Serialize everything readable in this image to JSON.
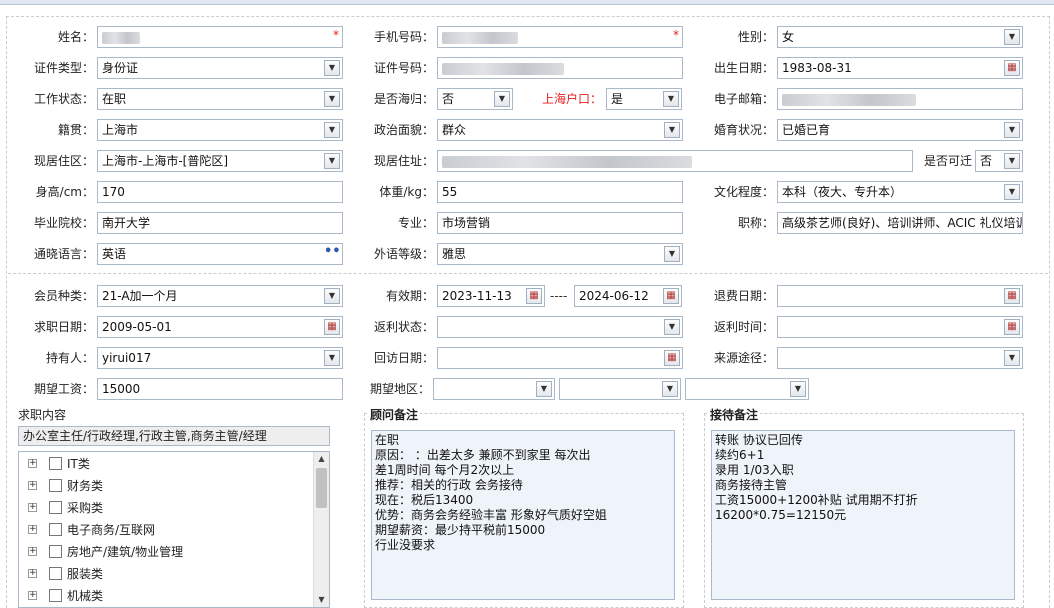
{
  "personal": {
    "name_label": "姓名：",
    "mobile_label": "手机号码：",
    "gender_label": "性别：",
    "gender_value": "女",
    "id_type_label": "证件类型：",
    "id_type_value": "身份证",
    "id_number_label": "证件号码：",
    "birth_label": "出生日期：",
    "birth_value": "1983-08-31",
    "work_status_label": "工作状态：",
    "work_status_value": "在职",
    "returnee_label": "是否海归：",
    "returnee_value": "否",
    "sh_hukou_label": "上海户口：",
    "sh_hukou_value": "是",
    "email_label": "电子邮箱：",
    "origin_label": "籍贯：",
    "origin_value": "上海市",
    "political_label": "政治面貌：",
    "political_value": "群众",
    "marital_label": "婚育状况：",
    "marital_value": "已婚已育",
    "residence_area_label": "现居住区：",
    "residence_area_value": "上海市-上海市-[普陀区]",
    "address_label": "现居住址：",
    "relocate_label": "是否可迁",
    "relocate_value": "否",
    "height_label": "身高/cm：",
    "height_value": "170",
    "weight_label": "体重/kg：",
    "weight_value": "55",
    "education_label": "文化程度：",
    "education_value": "本科（夜大、专升本）",
    "school_label": "毕业院校：",
    "school_value": "南开大学",
    "major_label": "专业：",
    "major_value": "市场营销",
    "title_label": "职称：",
    "title_value": "高级茶艺师(良好)、培训讲师、ACIC 礼仪培训",
    "language_label": "通晓语言：",
    "language_value": "英语",
    "lang_level_label": "外语等级：",
    "lang_level_value": "雅思"
  },
  "membership": {
    "member_type_label": "会员种类：",
    "member_type_value": "21-A加一个月",
    "valid_label": "有效期：",
    "valid_from": "2023-11-13",
    "valid_sep": "----",
    "valid_to": "2024-06-12",
    "refund_date_label": "退费日期：",
    "job_date_label": "求职日期：",
    "job_date_value": "2009-05-01",
    "rebate_status_label": "返利状态：",
    "rebate_time_label": "返利时间：",
    "holder_label": "持有人：",
    "holder_value": "yirui017",
    "visit_date_label": "回访日期：",
    "source_label": "来源途径：",
    "salary_label": "期望工资：",
    "salary_value": "15000",
    "region_label": "期望地区："
  },
  "job": {
    "title": "求职内容",
    "selected": "办公室主任/行政经理,行政主管,商务主管/经理",
    "categories": [
      "IT类",
      "财务类",
      "采购类",
      "电子商务/互联网",
      "房地产/建筑/物业管理",
      "服装类",
      "机械类"
    ]
  },
  "consultant": {
    "title": "顾问备注",
    "lines": [
      "在职",
      "原因：  ：出差太多  兼顾不到家里  每次出",
      "差1周时间  每个月2次以上",
      "推荐：相关的行政  会务接待",
      "现在：税后13400",
      "优势：商务会务经验丰富  形象好气质好空姐",
      "期望薪资：最少持平税前15000",
      "行业没要求"
    ]
  },
  "reception": {
    "title": "接待备注",
    "lines": [
      "  转账  协议已回传",
      "续约6+1",
      "",
      "录用 1/03入职",
      "商务接待主管",
      "工资15000+1200补贴 试用期不打折",
      "16200*0.75=12150元"
    ]
  }
}
